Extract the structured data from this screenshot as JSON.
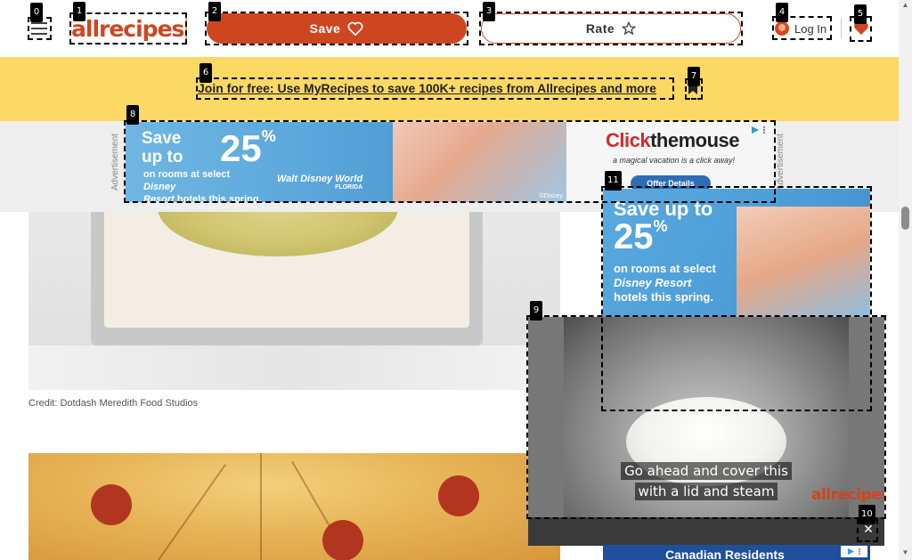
{
  "header": {
    "logo_text": "allrecipes",
    "save_label": "Save",
    "rate_label": "Rate",
    "login_label": "Log In"
  },
  "banner": {
    "text": "Join for free: Use MyRecipes to save 100K+ recipes from Allrecipes and more"
  },
  "leaderboard_ad": {
    "side_label": "Advertisement",
    "line1": "Save",
    "line2": "up to",
    "big_number": "25",
    "percent": "%",
    "sub_line1": "on rooms at select",
    "sub_line2": "Disney",
    "sub_line3": "Resort",
    "sub_line4": "hotels this spring.",
    "wdw": "Walt Disney World",
    "wdw_sub": "FLORIDA",
    "brand_part1": "Click",
    "brand_part2": "the",
    "brand_part3": "mouse",
    "tagline": "a magical vacation is a click away!",
    "offer_button": "Offer Details",
    "copyright": "©Disney"
  },
  "content": {
    "image1_credit": "Credit: Dotdash Meredith Food Studios"
  },
  "side_ad": {
    "line1": "Save up to",
    "big_number": "25",
    "percent": "%",
    "text1": "on rooms at select",
    "text2": "Disney Resort",
    "text3": "hotels this spring."
  },
  "video": {
    "caption_line1": "Go ahead and cover this",
    "caption_line2": "with a lid and steam",
    "logo": "allrecipes"
  },
  "bottom_ad": {
    "text": "Canadian Residents"
  },
  "markers": [
    {
      "id": "0"
    },
    {
      "id": "1"
    },
    {
      "id": "2"
    },
    {
      "id": "3"
    },
    {
      "id": "4"
    },
    {
      "id": "5"
    },
    {
      "id": "6"
    },
    {
      "id": "7"
    },
    {
      "id": "8"
    },
    {
      "id": "9"
    },
    {
      "id": "10"
    },
    {
      "id": "11"
    }
  ],
  "colors": {
    "brand": "#ce4620",
    "banner": "#fcd864"
  }
}
